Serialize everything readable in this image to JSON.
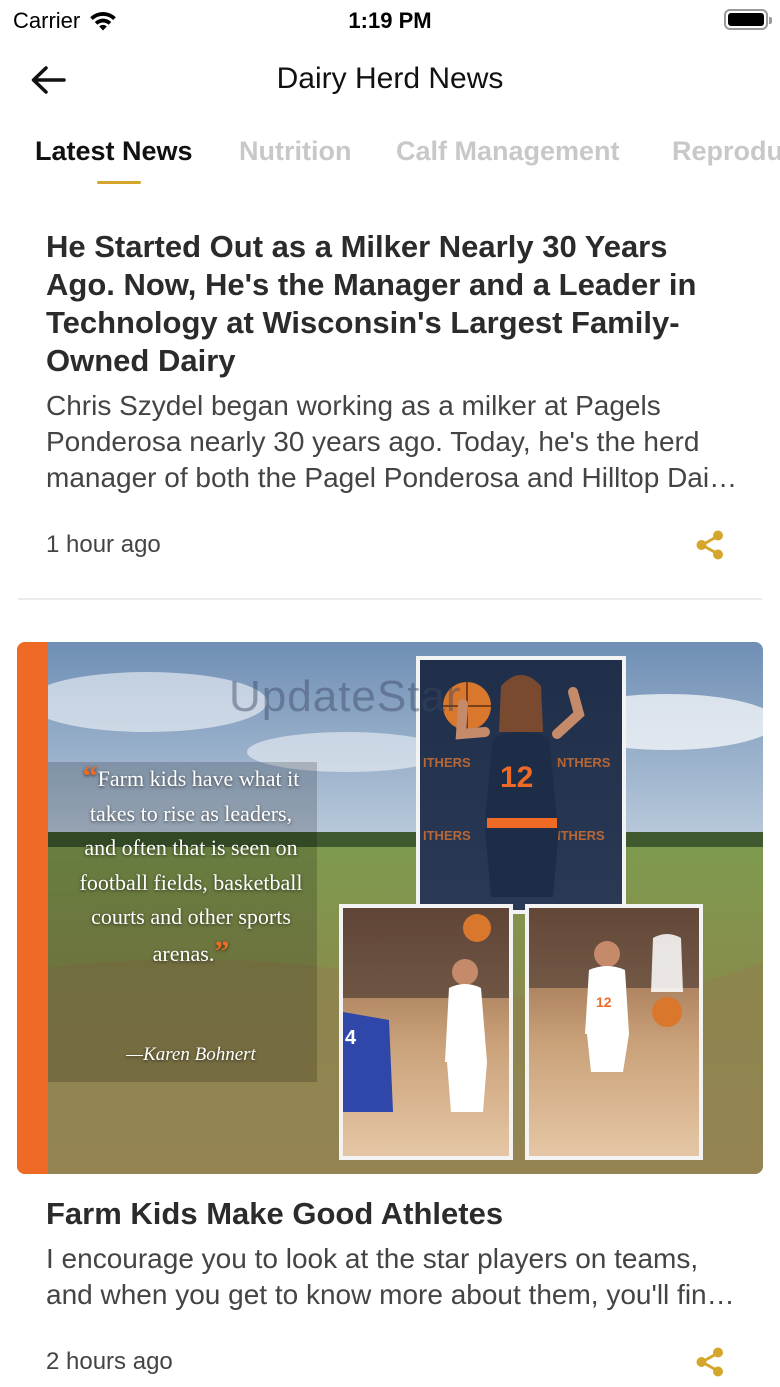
{
  "status": {
    "carrier": "Carrier",
    "time": "1:19 PM"
  },
  "nav": {
    "title": "Dairy Herd News",
    "back_icon": "arrow-left-icon"
  },
  "tabs": [
    {
      "label": "Latest News",
      "active": true
    },
    {
      "label": "Nutrition",
      "active": false
    },
    {
      "label": "Calf Management",
      "active": false
    },
    {
      "label": "Reproduction",
      "active": false
    }
  ],
  "colors": {
    "accent": "#d4a72c",
    "inactive_tab": "#c8c8c8",
    "hero_orange": "#ef6b25"
  },
  "articles": [
    {
      "title": "He Started Out as a Milker Nearly 30 Years Ago. Now, He's the Manager and a Leader in Technology at Wisconsin's Largest Family-Owned Dairy",
      "summary": "Chris Szydel began working as a milker at Pagels Ponderosa nearly 30 years ago. Today, he's the herd manager of both the Pagel Ponderosa and Hilltop Dairy operations.",
      "time": "1 hour ago",
      "share_icon": "share-icon"
    },
    {
      "title": "Farm Kids Make Good Athletes",
      "summary": "I encourage you to look at the star players on teams, and when you get to know more about them, you'll find many grew up on farms.",
      "time": "2 hours ago",
      "share_icon": "share-icon",
      "image": {
        "quote": "Farm kids have what it takes to rise as leaders, and often that is seen on football fields, basketball courts and other sports arenas.",
        "attribution": "—Karen Bohnert",
        "watermark": "UpdateStar"
      }
    }
  ]
}
